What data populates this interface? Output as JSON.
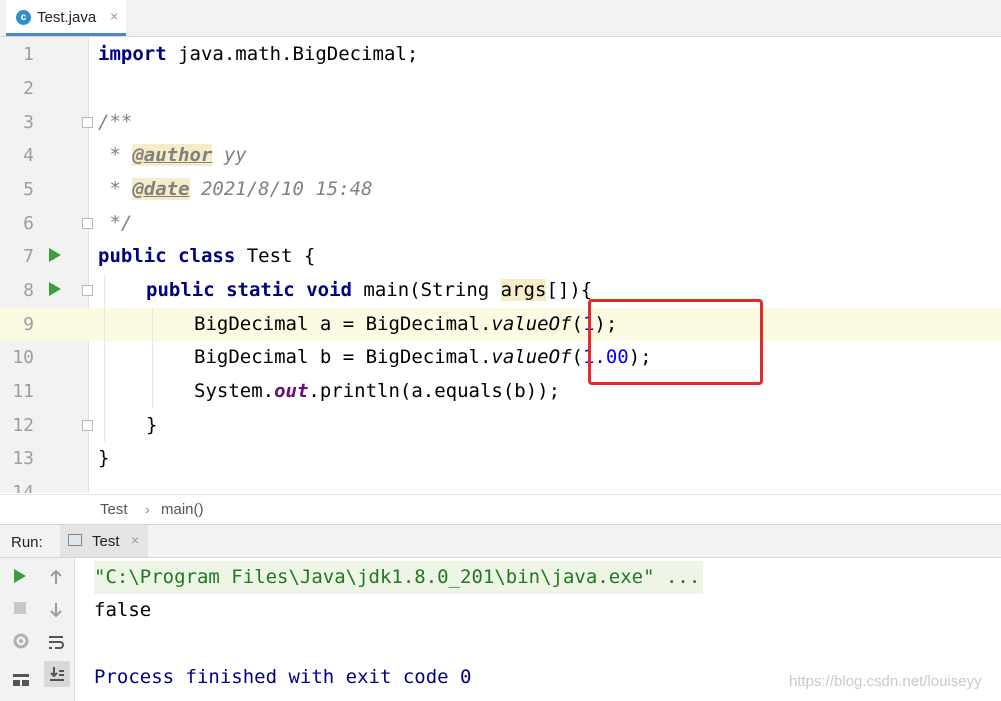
{
  "tab": {
    "icon": "c",
    "label": "Test.java",
    "close": "×"
  },
  "gutter": {
    "line_numbers": [
      "1",
      "2",
      "3",
      "4",
      "5",
      "6",
      "7",
      "8",
      "9",
      "10",
      "11",
      "12",
      "13",
      "14"
    ]
  },
  "code": {
    "l1_kw": "import",
    "l1_rest": " java.math.BigDecimal;",
    "l3": "/**",
    "l4_star": " * ",
    "l4_tag": "@author",
    "l4_rest": " yy",
    "l5_star": " * ",
    "l5_tag": "@date",
    "l5_rest": " 2021/8/10 15:48",
    "l6": " */",
    "l7_kw1": "public",
    "l7_kw2": "class",
    "l7_rest": " Test {",
    "l8_kw1": "public",
    "l8_kw2": "static",
    "l8_kw3": "void",
    "l8_a": " main(String ",
    "l8_param": "args",
    "l8_b": "[]){",
    "l9_a": "BigDecimal a = BigDecimal.",
    "l9_method": "valueOf",
    "l9_b": "(",
    "l9_num": "1",
    "l9_c": ");",
    "l10_a": "BigDecimal b = BigDecimal.",
    "l10_method": "valueOf",
    "l10_b": "(",
    "l10_num": "1.00",
    "l10_c": ");",
    "l11_a": "System.",
    "l11_field": "out",
    "l11_b": ".println(a.equals(b));",
    "l12": "}",
    "l13": "}"
  },
  "breadcrumb": {
    "items": [
      "Test",
      "main()"
    ],
    "separator": "›"
  },
  "run_panel": {
    "label": "Run:",
    "tab_label": "Test",
    "tab_close": "×",
    "console": [
      "\"C:\\Program Files\\Java\\jdk1.8.0_201\\bin\\java.exe\" ...",
      "false",
      "Process finished with exit code 0"
    ]
  },
  "watermark": "https://blog.csdn.net/louiseyy",
  "colors": {
    "highlight_box": "#e52a2a",
    "run_green": "#3e9c40",
    "keyword": "#000080"
  }
}
